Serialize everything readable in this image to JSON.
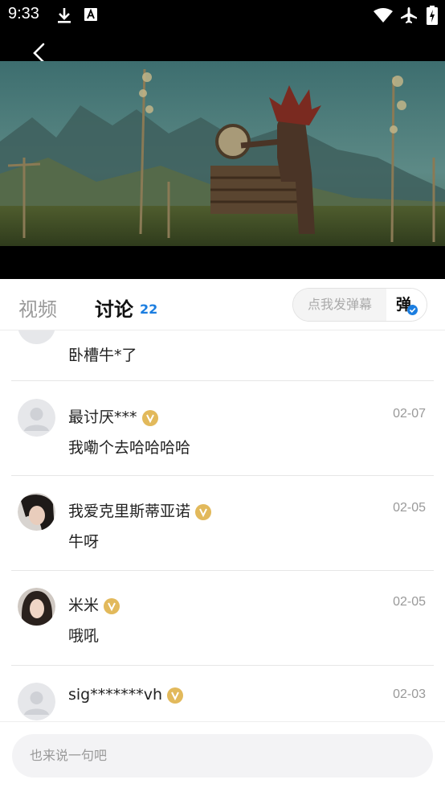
{
  "status_bar": {
    "time": "9:33"
  },
  "tabs": {
    "video": "视频",
    "discuss": "讨论",
    "count": "22"
  },
  "danmaku": {
    "placeholder": "点我发弹幕",
    "button": "弹"
  },
  "comments": [
    {
      "name": "",
      "date": "",
      "text": "卧槽牛*了"
    },
    {
      "name": "最讨厌***",
      "date": "02-07",
      "text": "我嘞个去哈哈哈哈"
    },
    {
      "name": "我爱克里斯蒂亚诺",
      "date": "02-05",
      "text": "牛呀"
    },
    {
      "name": "米米",
      "date": "02-05",
      "text": "哦吼"
    },
    {
      "name": "sig*******vh",
      "date": "02-03",
      "text": ""
    }
  ],
  "footer": {
    "placeholder": "也来说一句吧"
  },
  "colors": {
    "accent": "#1c7ee0",
    "badge": "#e2b95b"
  }
}
